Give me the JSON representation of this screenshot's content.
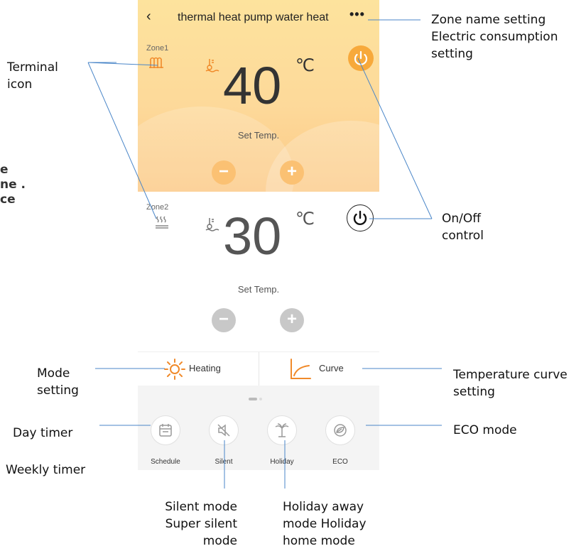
{
  "app": {
    "title": "thermal heat pump water heat",
    "back_icon": "chevron-left-icon",
    "more_icon": "more-horizontal-icon"
  },
  "zone1": {
    "label": "Zone1",
    "temperature": "40",
    "unit": "℃",
    "set_label": "Set Temp.",
    "minus": "−",
    "plus": "+",
    "accent": "#f7a93b"
  },
  "zone2": {
    "label": "Zone2",
    "temperature": "30",
    "unit": "℃",
    "set_label": "Set Temp.",
    "minus": "−",
    "plus": "+"
  },
  "modebar": {
    "mode_label": "Heating",
    "mode_icon": "sun-icon",
    "curve_label": "Curve",
    "curve_icon": "curve-icon",
    "accent": "#f08a2a"
  },
  "features": [
    {
      "label": "Schedule",
      "icon": "calendar-icon"
    },
    {
      "label": "Silent",
      "icon": "speaker-mute-icon"
    },
    {
      "label": "Holiday",
      "icon": "palm-tree-icon"
    },
    {
      "label": "ECO",
      "icon": "eco-leaf-icon"
    }
  ],
  "annotations": {
    "terminal": [
      "Terminal",
      "icon"
    ],
    "zone_name": [
      "Zone name setting",
      "Electric consumption",
      "setting"
    ],
    "onoff": [
      "On/Off",
      "control"
    ],
    "mode": [
      "Mode",
      "setting"
    ],
    "curve": [
      "Temperature curve",
      "setting"
    ],
    "day_timer": "Day timer",
    "weekly_timer": "Weekly timer",
    "eco": "ECO mode",
    "silent": [
      "Silent mode",
      "Super silent",
      "mode"
    ],
    "holiday": [
      "Holiday away",
      "mode Holiday",
      "home mode"
    ]
  },
  "left_fragments": [
    "e",
    "ne .",
    "ce"
  ]
}
